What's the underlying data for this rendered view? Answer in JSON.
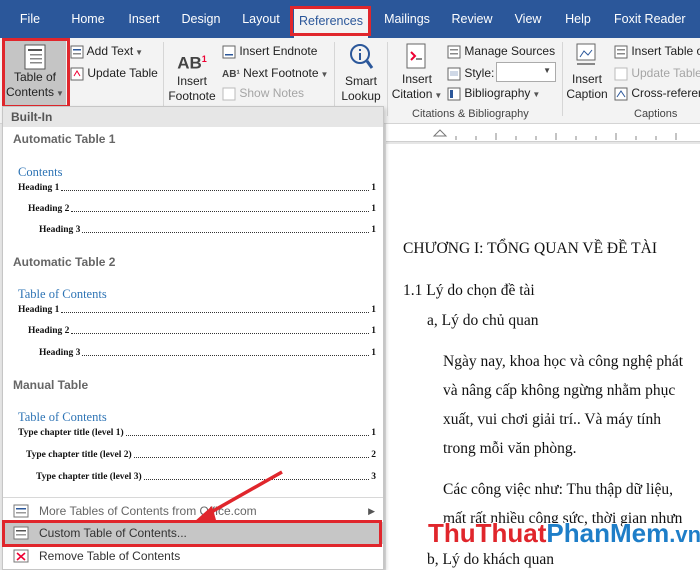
{
  "tabs": [
    "File",
    "Home",
    "Insert",
    "Design",
    "Layout",
    "References",
    "Mailings",
    "Review",
    "View",
    "Help",
    "Foxit Reader PDF"
  ],
  "active_tab": "References",
  "ribbon": {
    "toc_button": {
      "line1": "Table of",
      "line2": "Contents"
    },
    "add_text": "Add Text",
    "update_table": "Update Table",
    "insert_footnote": {
      "line1": "Insert",
      "line2": "Footnote"
    },
    "insert_endnote": "Insert Endnote",
    "next_footnote": "Next Footnote",
    "show_notes": "Show Notes",
    "smart_lookup": {
      "line1": "Smart",
      "line2": "Lookup"
    },
    "insert_citation": {
      "line1": "Insert",
      "line2": "Citation"
    },
    "manage_sources": "Manage Sources",
    "style_label": "Style:",
    "bibliography": "Bibliography",
    "insert_caption": {
      "line1": "Insert",
      "line2": "Caption"
    },
    "insert_table_of_figures": "Insert Table o",
    "update_table_figures": "Update Table",
    "cross_reference": "Cross-referen",
    "group_citations": "Citations & Bibliography",
    "group_captions": "Captions"
  },
  "dropdown": {
    "section": "Built-In",
    "galleries": [
      {
        "name": "Automatic Table 1",
        "heading": "Contents",
        "rows": [
          {
            "label": "Heading 1",
            "page": "1"
          },
          {
            "label": "Heading 2",
            "page": "1"
          },
          {
            "label": "Heading 3",
            "page": "1"
          }
        ]
      },
      {
        "name": "Automatic Table 2",
        "heading": "Table of Contents",
        "rows": [
          {
            "label": "Heading 1",
            "page": "1"
          },
          {
            "label": "Heading 2",
            "page": "1"
          },
          {
            "label": "Heading 3",
            "page": "1"
          }
        ]
      },
      {
        "name": "Manual Table",
        "heading": "Table of Contents",
        "rows": [
          {
            "label": "Type chapter title (level 1)",
            "page": "1"
          },
          {
            "label": "Type chapter title (level 2)",
            "page": "2"
          },
          {
            "label": "Type chapter title (level 3)",
            "page": "3"
          }
        ]
      }
    ],
    "more_tables": "More Tables of Contents from Office.com",
    "custom_toc": "Custom Table of Contents...",
    "remove_toc": "Remove Table of Contents"
  },
  "document": {
    "chapter": "CHƯƠNG I: TỔNG QUAN VỀ ĐỀ TÀI",
    "section": "1.1 Lý do chọn đề tài",
    "subsection_a": "a, Lý do chủ quan",
    "para1": [
      "Ngày nay, khoa học và công nghệ phát",
      "và nâng cấp không ngừng nhằm phục",
      "xuất, vui chơi giải trí.. Và máy tính",
      "trong mỗi văn phòng."
    ],
    "para2": [
      "Các công việc như: Thu thập dữ liệu,",
      "mất rất nhiều công sức, thời gian nhưn"
    ],
    "subsection_b": "b, Lý do khách quan"
  },
  "watermark": {
    "part1": "Thu",
    "part2": "Thuat",
    "part3": "PhanMem",
    "part4": ".vn"
  },
  "colors": {
    "ribbon_blue": "#2b579a",
    "highlight_red": "#e0262c",
    "toc_heading_blue": "#2e74b5",
    "menu_highlight": "#c6c6c6"
  }
}
